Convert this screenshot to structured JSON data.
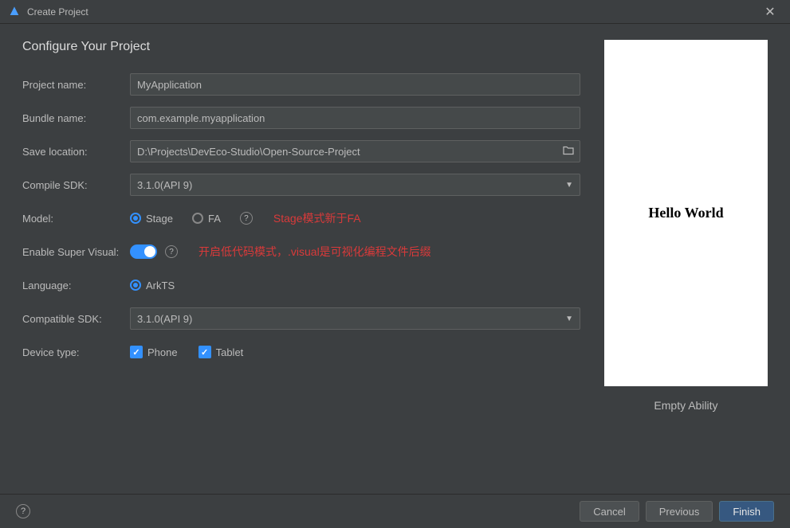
{
  "window": {
    "title": "Create Project"
  },
  "heading": "Configure Your Project",
  "labels": {
    "project_name": "Project name:",
    "bundle_name": "Bundle name:",
    "save_location": "Save location:",
    "compile_sdk": "Compile SDK:",
    "model": "Model:",
    "enable_super_visual": "Enable Super Visual:",
    "language": "Language:",
    "compatible_sdk": "Compatible SDK:",
    "device_type": "Device type:"
  },
  "values": {
    "project_name": "MyApplication",
    "bundle_name": "com.example.myapplication",
    "save_location": "D:\\Projects\\DevEco-Studio\\Open-Source-Project",
    "compile_sdk": "3.1.0(API 9)",
    "compatible_sdk": "3.1.0(API 9)"
  },
  "model": {
    "stage": "Stage",
    "fa": "FA",
    "selected": "stage"
  },
  "annotations": {
    "model": "Stage模式新于FA",
    "super_visual": "开启低代码模式，.visual是可视化编程文件后缀"
  },
  "language": {
    "arkts": "ArkTS"
  },
  "device_type": {
    "phone": "Phone",
    "tablet": "Tablet"
  },
  "preview": {
    "text": "Hello World",
    "label": "Empty Ability"
  },
  "buttons": {
    "cancel": "Cancel",
    "previous": "Previous",
    "finish": "Finish"
  }
}
